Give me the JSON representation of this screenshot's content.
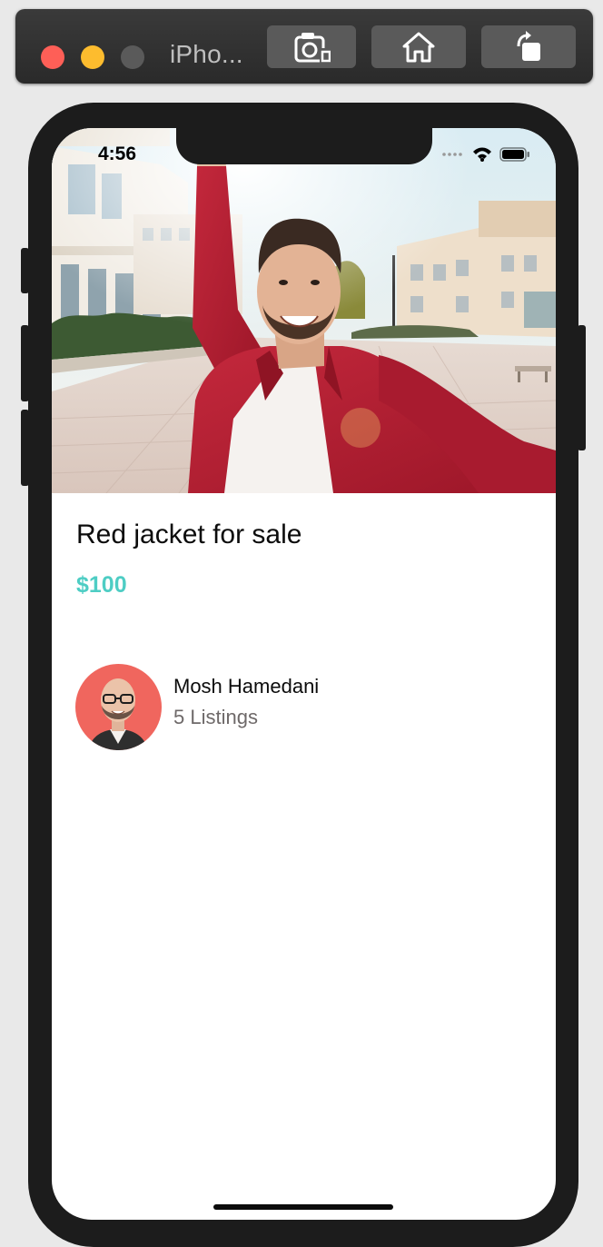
{
  "simulator": {
    "title": "iPho...",
    "buttons": [
      "camera-icon",
      "home-icon",
      "rotate-icon"
    ]
  },
  "status_bar": {
    "time": "4:56",
    "icons": [
      "signal-icon",
      "wifi-icon",
      "battery-icon"
    ]
  },
  "listing": {
    "image": "man-in-red-jacket-selfie",
    "title": "Red jacket for sale",
    "price": "$100"
  },
  "seller": {
    "name": "Mosh Hamedani",
    "listings": "5 Listings"
  },
  "colors": {
    "price": "#4ecdc4",
    "avatar_bg": "#f0665e",
    "jacket": "#b71d33"
  }
}
